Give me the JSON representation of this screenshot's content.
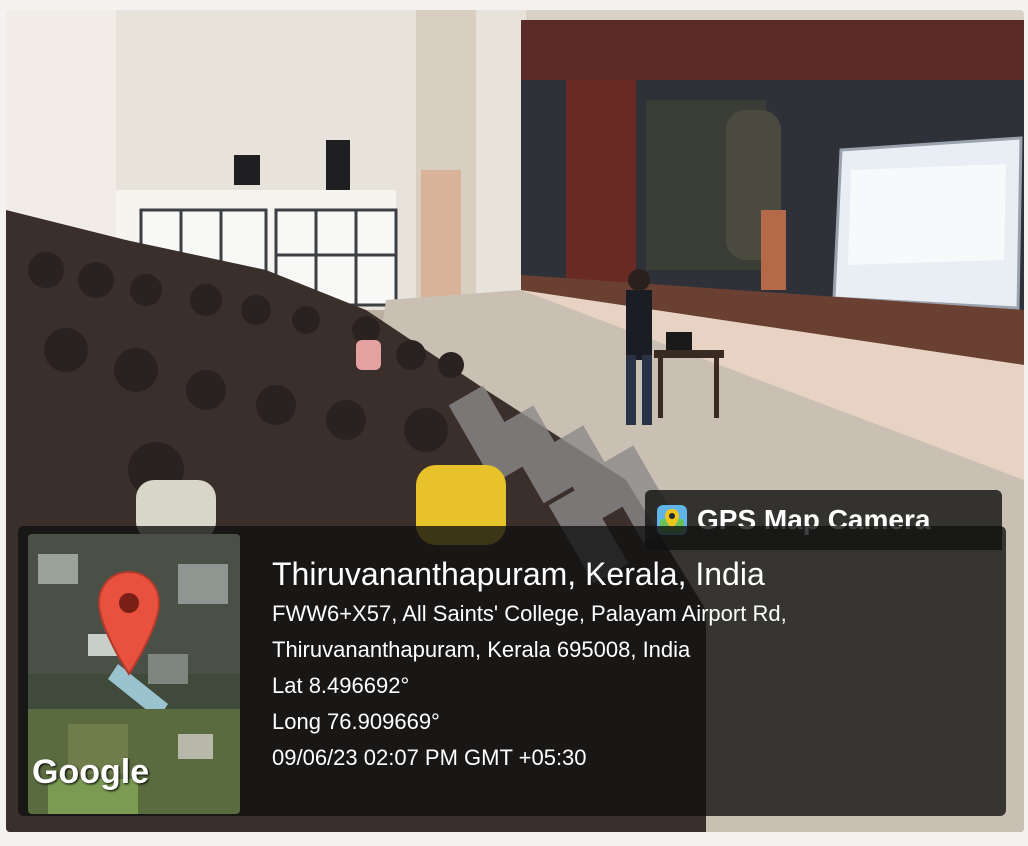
{
  "badge": {
    "icon": "map-pin-icon",
    "text": "GPS Map Camera"
  },
  "map": {
    "marker_icon": "location-marker-icon",
    "provider": "Google"
  },
  "location": {
    "city": "Thiruvananthapuram, Kerala, India",
    "address_line1": "FWW6+X57, All Saints' College, Palayam Airport Rd,",
    "address_line2": "Thiruvananthapuram, Kerala 695008, India",
    "lat": "Lat 8.496692°",
    "long": "Long 76.909669°",
    "datetime": "09/06/23 02:07 PM GMT +05:30"
  },
  "colors": {
    "overlay": "#121212",
    "marker": "#e8513d",
    "screen": "#e9eef4",
    "curtain": "#6a2a24"
  }
}
